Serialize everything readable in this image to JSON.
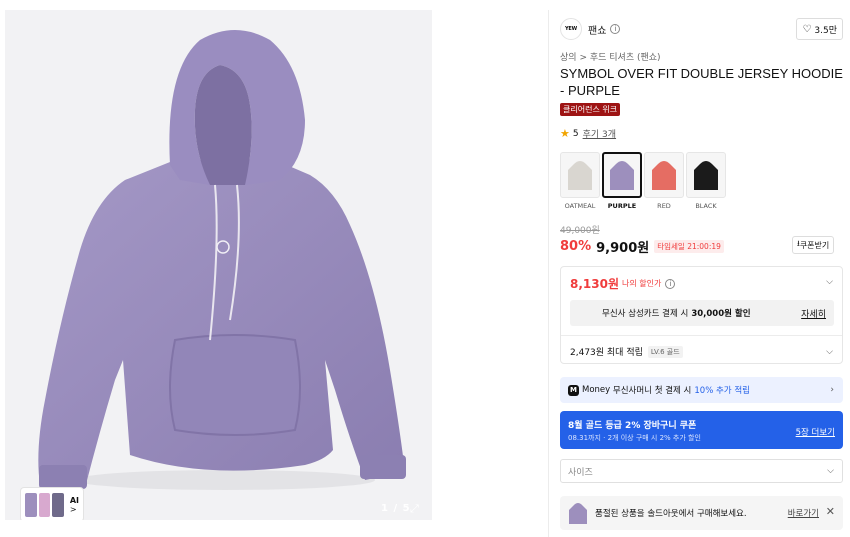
{
  "gallery": {
    "counter": "1 / 5",
    "ai_label": "AI",
    "ai_arrow": ">",
    "expand_icon": "expand-icon"
  },
  "brand": {
    "logo_text": "YEW",
    "name": "팬쇼",
    "info_glyph": "i",
    "likes": "3.5만"
  },
  "breadcrumb": {
    "category": "상의",
    "sep": ">",
    "subcategory": "후드 티셔츠 (팬쇼)"
  },
  "product": {
    "title": "SYMBOL OVER FIT DOUBLE JERSEY HOODIE - PURPLE",
    "badge": "클리어런스 위크",
    "rating": "5",
    "reviews": "후기 3개"
  },
  "colors": [
    {
      "label": "OATMEAL",
      "hex": "#d9d6d0",
      "selected": false
    },
    {
      "label": "PURPLE",
      "hex": "#9d8fbd",
      "selected": true
    },
    {
      "label": "RED",
      "hex": "#e56d63",
      "selected": false
    },
    {
      "label": "BLACK",
      "hex": "#1b1b1b",
      "selected": false
    }
  ],
  "price": {
    "original": "49,000원",
    "discount": "80%",
    "sale": "9,900원",
    "timesale": "타임세일 21:00:19",
    "coupon_button": "쿠폰받기",
    "coupon_glyph": "⭳"
  },
  "benefit": {
    "my_price": "8,130원",
    "my_price_label": "나의 할인가",
    "card_offer_prefix": "무신사 삼성카드 결제 시",
    "card_offer_amount": "30,000원 할인",
    "card_offer_detail": "자세히",
    "points": "2,473원 최대 적립",
    "level": "LV.6 골드"
  },
  "money": {
    "icon_text": "M",
    "brand": "Money",
    "text": "무신사머니 첫 결제 시",
    "highlight": "10% 추가 적립"
  },
  "coupon_banner": {
    "title": "8월 골드 등급 2% 장바구니 쿠폰",
    "subtitle": "08.31까지 · 2개 이상 구매 시 2% 추가 할인",
    "more": "5장 더보기"
  },
  "size": {
    "placeholder": "사이즈"
  },
  "soldout": {
    "text": "품절된 상품을 솔드아웃에서 구매해보세요.",
    "link": "바로가기",
    "close": "✕"
  },
  "icons": {
    "chevron_down": "⌵",
    "chevron_right": "›",
    "heart": "♡",
    "star": "★"
  },
  "theme": {
    "accent_red": "#f03c3c",
    "accent_blue": "#2461e8",
    "badge_red": "#9e1414",
    "hoodie_purple": "#9d8fbd"
  }
}
